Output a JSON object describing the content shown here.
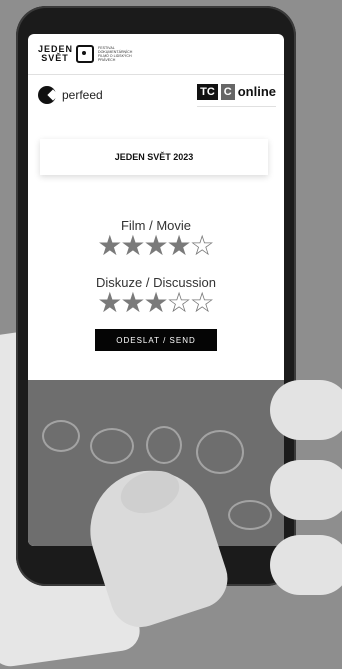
{
  "header": {
    "festival_logo_line1": "JEDEN",
    "festival_logo_line2": "SVĚT",
    "festival_logo_small": "FESTIVAL DOKUMENTÁRNÍCH FILMŮ O LIDSKÝCH PRÁVECH"
  },
  "brands": {
    "perfeed_label": "perfeed",
    "tc_part1": "TC",
    "tc_part2": "C",
    "tc_online": "online"
  },
  "event": {
    "title": "JEDEN SVĚT 2023"
  },
  "ratings": [
    {
      "label": "Film / Movie",
      "value": 4,
      "max": 5
    },
    {
      "label": "Diskuze / Discussion",
      "value": 3,
      "max": 5
    }
  ],
  "send_button_label": "ODESLAT / SEND",
  "icons": [
    "perfeed-logo-icon",
    "star-icon"
  ]
}
